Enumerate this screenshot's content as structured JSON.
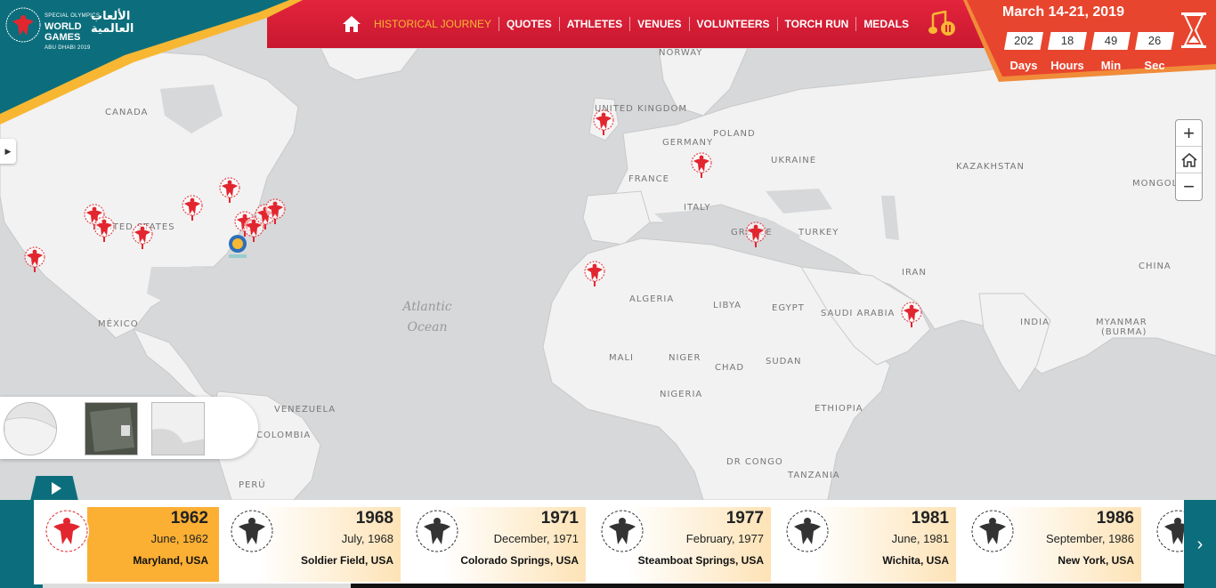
{
  "header": {
    "logo": {
      "line_small": "SPECIAL OLYMPICS",
      "line1": "WORLD",
      "line2": "GAMES",
      "line_sub": "ABU DHABI 2019",
      "arabic1": "الألعاب",
      "arabic2": "العالمية"
    },
    "nav": [
      {
        "label": "HISTORICAL JOURNEY",
        "active": true
      },
      {
        "label": "QUOTES"
      },
      {
        "label": "ATHLETES"
      },
      {
        "label": "VENUES"
      },
      {
        "label": "VOLUNTEERS"
      },
      {
        "label": "TORCH RUN"
      },
      {
        "label": "MEDALS"
      }
    ],
    "icons": {
      "home": "home-icon",
      "music": "music-pause-icon"
    }
  },
  "countdown": {
    "date": "March 14-21, 2019",
    "values": [
      "202",
      "18",
      "49",
      "26"
    ],
    "labels": [
      "Days",
      "Hours",
      "Min",
      "Sec"
    ],
    "icon": "hourglass-icon"
  },
  "map": {
    "labels": [
      "NORWAY",
      "CANADA",
      "UNITED KINGDOM",
      "GERMANY",
      "POLAND",
      "UKRAINE",
      "KAZAKHSTAN",
      "MONGOL",
      "FRANCE",
      "ITALY",
      "GREECE",
      "TURKEY",
      "UNITED STATES",
      "IRAN",
      "CHINA",
      "ALGERIA",
      "LIBYA",
      "EGYPT",
      "SAUDI ARABIA",
      "INDIA",
      "MYANMAR",
      "(BURMA)",
      "MÉXICO",
      "MALI",
      "NIGER",
      "CHAD",
      "SUDAN",
      "NIGERIA",
      "ETHIOPIA",
      "VENEZUELA",
      "COLOMBIA",
      "DR CONGO",
      "TANZANIA",
      "PERÚ"
    ],
    "ocean": [
      "Atlantic",
      "Ocean"
    ],
    "zoom": {
      "plus": "+",
      "minus": "−"
    },
    "colors": {
      "marker": "#e2262f",
      "water": "#d7d8da",
      "land": "#f2f2f2"
    }
  },
  "timeline": {
    "items": [
      {
        "year": "1962",
        "date": "June, 1962",
        "place": "Maryland, USA",
        "active": true
      },
      {
        "year": "1968",
        "date": "July, 1968",
        "place": "Soldier Field, USA"
      },
      {
        "year": "1971",
        "date": "December, 1971",
        "place": "Colorado Springs, USA"
      },
      {
        "year": "1977",
        "date": "February, 1977",
        "place": "Steamboat Springs, USA"
      },
      {
        "year": "1981",
        "date": "June, 1981",
        "place": "Wichita, USA"
      },
      {
        "year": "1986",
        "date": "September, 1986",
        "place": "New York, USA"
      }
    ],
    "next": "›"
  },
  "colors": {
    "brand_red": "#d81f36",
    "brand_teal": "#0c6e7c",
    "accent": "#fbb034"
  }
}
